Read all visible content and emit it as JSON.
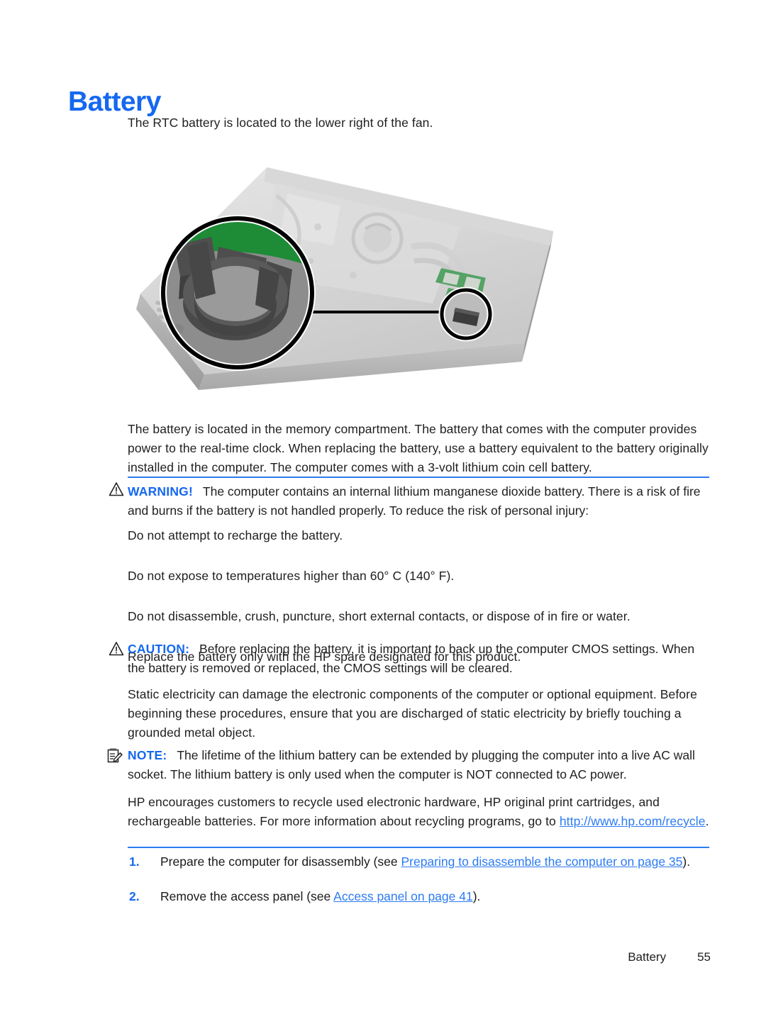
{
  "document": {
    "title": "Battery",
    "title_color": "#1568ef",
    "rule_color": "#2c7bf2",
    "link_color": "#2c7bf2"
  },
  "intro": {
    "text": "The RTC battery is located to the lower right of the fan."
  },
  "figure": {
    "name": "laptop-bottom-rtc-battery-illustration",
    "alt": "Bottom view of laptop chassis with callout circle magnifying the RTC battery socket",
    "colors": {
      "chassis_light": "#d4d4d4",
      "chassis_mid": "#bdbdbd",
      "chassis_dark": "#9e9e9e",
      "socket_dark": "#4a4a4a",
      "pcb_green": "#1e8b36",
      "outline": "#000000"
    }
  },
  "paragraphs": {
    "location": "The battery is located in the memory compartment. The battery that comes with the computer provides power to the real-time clock. When replacing the battery, use a battery equivalent to the battery originally installed in the computer. The computer comes with a 3-volt lithium coin cell battery.",
    "static_electricity": "Static electricity can damage the electronic components of the computer or optional equipment. Before beginning these procedures, ensure that you are discharged of static electricity by briefly touching a grounded metal object.",
    "recycle_intro": "HP encourages customers to recycle used electronic hardware, HP original print cartridges, and rechargeable batteries. For more information about recycling programs, go to ",
    "recycle_link": "http://www.hp.com/recycle",
    "recycle_period": "."
  },
  "warning": {
    "icon": "warning-triangle-icon",
    "label": "WARNING!",
    "text": "The computer contains an internal lithium manganese dioxide battery. There is a risk of fire and burns if the battery is not handled properly. To reduce the risk of personal injury:",
    "has_rule": true
  },
  "warning_items": [
    "Do not attempt to recharge the battery.",
    "Do not expose to temperatures higher than 60° C (140° F).",
    "Do not disassemble, crush, puncture, short external contacts, or dispose of in fire or water.",
    "Replace the battery only with the HP spare designated for this product."
  ],
  "caution": {
    "icon": "caution-triangle-icon",
    "label": "CAUTION:",
    "text": "Before replacing the battery, it is important to back up the computer CMOS settings. When the battery is removed or replaced, the CMOS settings will be cleared.",
    "has_rule": false
  },
  "note": {
    "icon": "note-clipboard-icon",
    "label": "NOTE:",
    "text": "The lifetime of the lithium battery can be extended by plugging the computer into a live AC wall socket. The lithium battery is only used when the computer is NOT connected to AC power.",
    "has_rule": false
  },
  "steps": [
    {
      "number": "1.",
      "prefix": "Prepare the computer for disassembly (see ",
      "link": "Preparing to disassemble the computer on page 35",
      "suffix": ")."
    },
    {
      "number": "2.",
      "prefix": "Remove the access panel (see ",
      "link": "Access panel on page 41",
      "suffix": ")."
    }
  ],
  "footer": {
    "chapter": "Battery",
    "page_number": "55"
  }
}
